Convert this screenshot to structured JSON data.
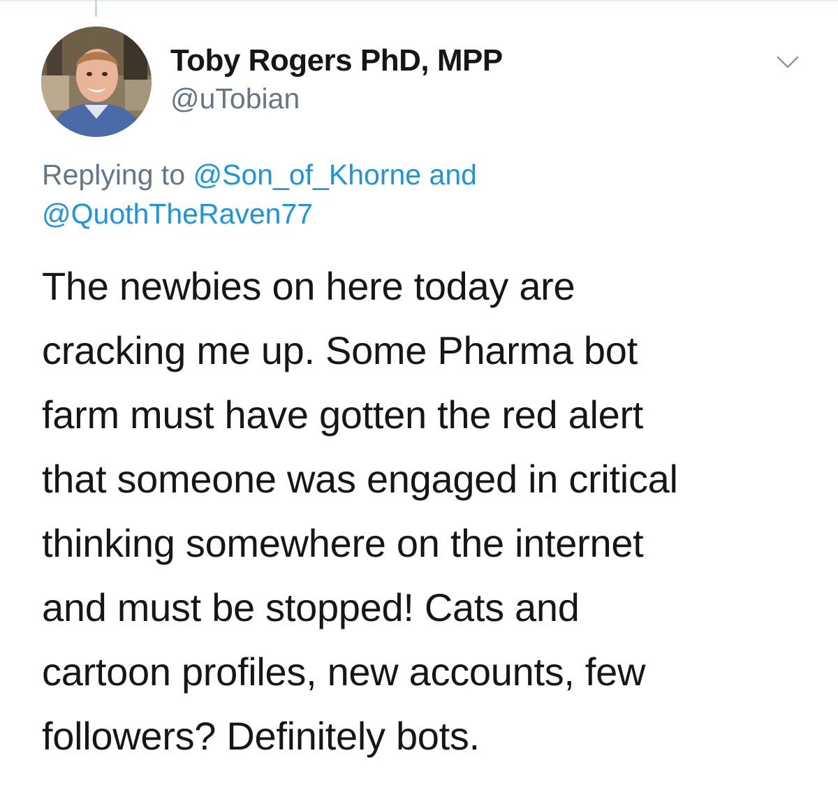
{
  "author": {
    "display_name": "Toby Rogers PhD, MPP",
    "handle": "@uTobian"
  },
  "menu": {
    "icon": "chevron-down-icon"
  },
  "reply": {
    "prefix": "Replying to",
    "mention_1": "@Son_of_Khorne",
    "conjunction": "and",
    "mention_2": "@QuothTheRaven77"
  },
  "tweet": {
    "lines": [
      "The newbies on here today are",
      "cracking me up. Some Pharma bot",
      "farm must have gotten the red alert",
      "that someone was engaged in critical",
      "thinking somewhere on the internet",
      "and must be stopped! Cats and",
      "cartoon profiles, new accounts, few",
      "followers? Definitely bots."
    ]
  },
  "colors": {
    "text": "#14171a",
    "secondary": "#657786",
    "mention": "#1b95e0"
  }
}
